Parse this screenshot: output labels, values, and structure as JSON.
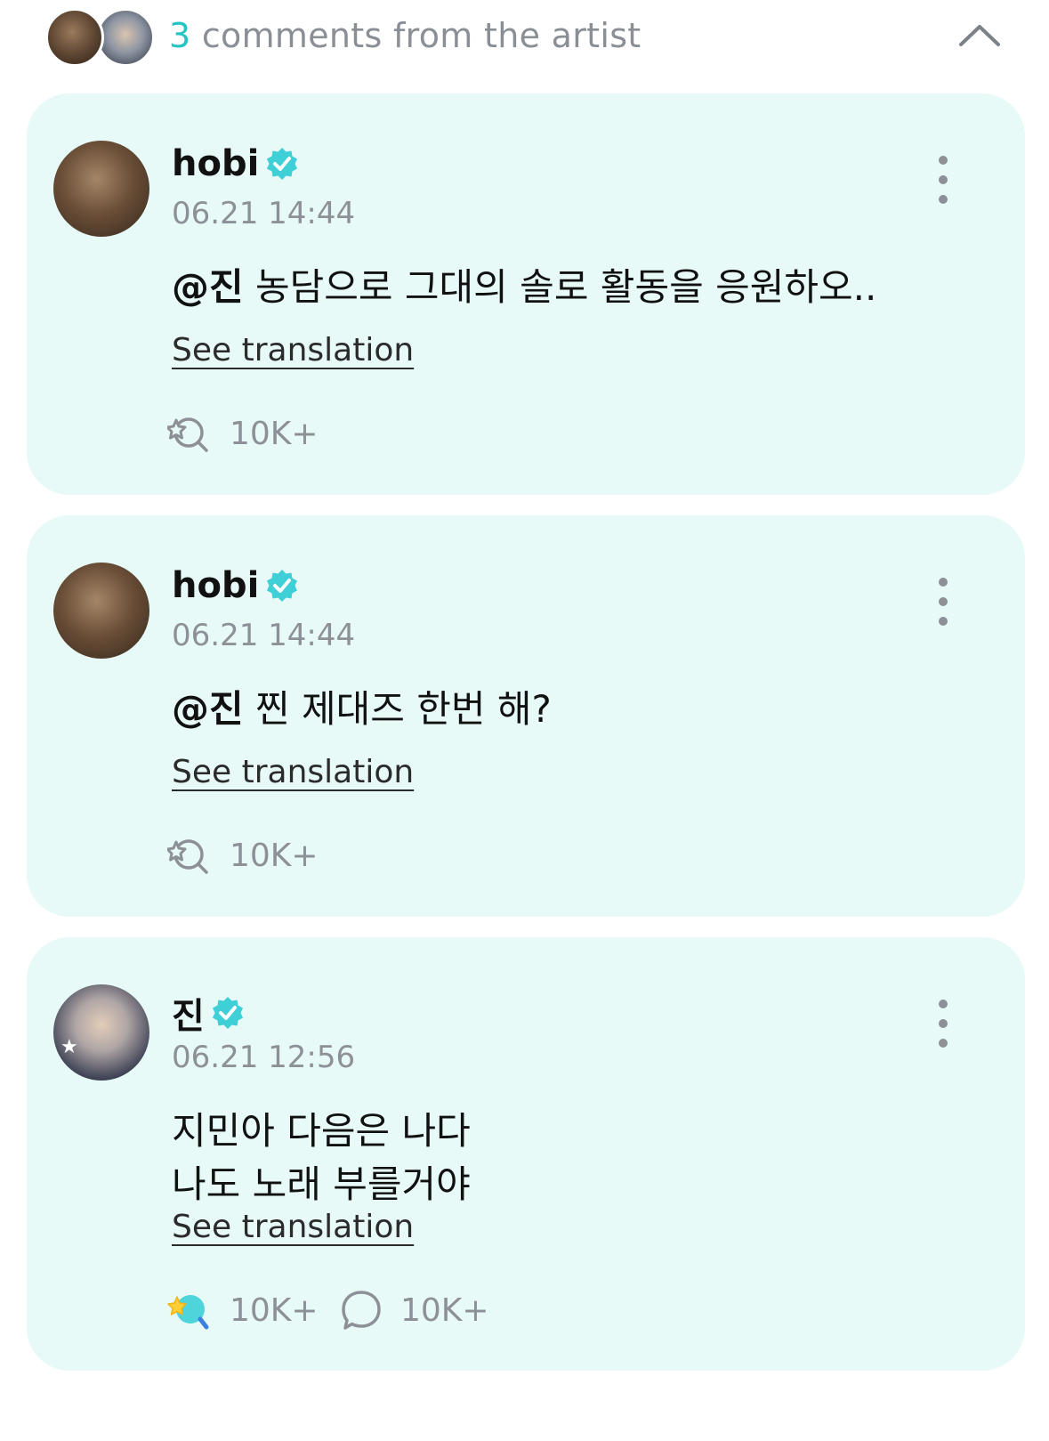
{
  "header": {
    "count": "3",
    "title_rest": " comments from the artist"
  },
  "comments": [
    {
      "author": "hobi",
      "time": "06.21 14:44",
      "mention": "@진",
      "text": " 농담으로 그대의 솔로 활동을 응원하오..",
      "translate_label": "See translation",
      "reactions": "10K+"
    },
    {
      "author": "hobi",
      "time": "06.21 14:44",
      "mention": "@진",
      "text": " 찐 제대즈 한번 해?",
      "translate_label": "See translation",
      "reactions": "10K+"
    },
    {
      "author": "진",
      "time": "06.21 12:56",
      "text_line1": "지민아 다음은 나다",
      "text_line2": "나도 노래 부를거야",
      "translate_label": "See translation",
      "reactions": "10K+",
      "replies": "10K+"
    }
  ],
  "colors": {
    "accent": "#22c4c4",
    "card_background": "#e7faf7",
    "muted_text": "#8d9197"
  },
  "icons": [
    "collapse-chevron-up-icon",
    "verified-badge-icon",
    "more-options-icon",
    "reaction-icon",
    "comment-bubble-icon"
  ]
}
